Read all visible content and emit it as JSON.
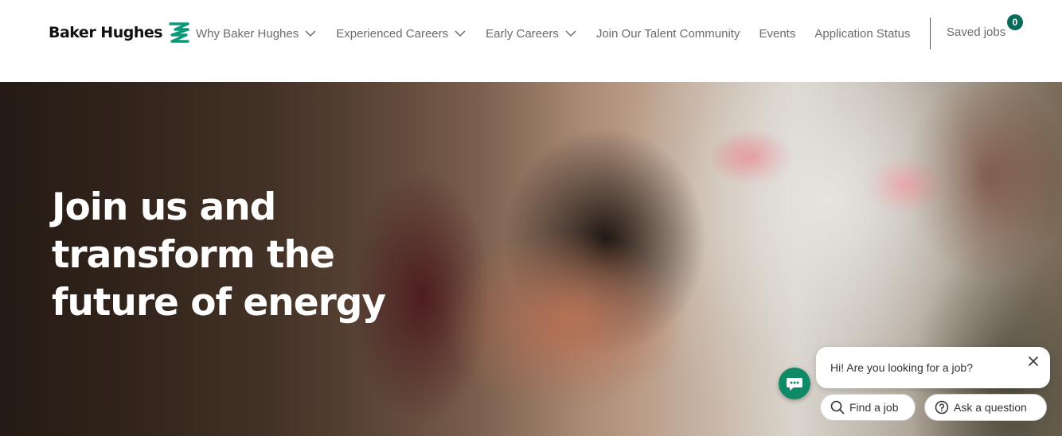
{
  "header": {
    "logo_text": "Baker Hughes",
    "logo_color": "#0b9a78",
    "nav": [
      {
        "label": "Why Baker Hughes",
        "has_dropdown": true
      },
      {
        "label": "Experienced Careers",
        "has_dropdown": true
      },
      {
        "label": "Early Careers",
        "has_dropdown": true
      },
      {
        "label": "Join Our Talent Community",
        "has_dropdown": false
      },
      {
        "label": "Events",
        "has_dropdown": false
      },
      {
        "label": "Application Status",
        "has_dropdown": false
      }
    ],
    "saved_jobs_label": "Saved jobs",
    "saved_jobs_count": "0"
  },
  "hero": {
    "title_lines": [
      "Join us and",
      "transform the",
      "future of energy"
    ]
  },
  "chat": {
    "message": "Hi! Are you looking for a job?",
    "find_job_label": "Find a job",
    "ask_question_label": "Ask a question",
    "accent_color": "#0f8a66"
  }
}
